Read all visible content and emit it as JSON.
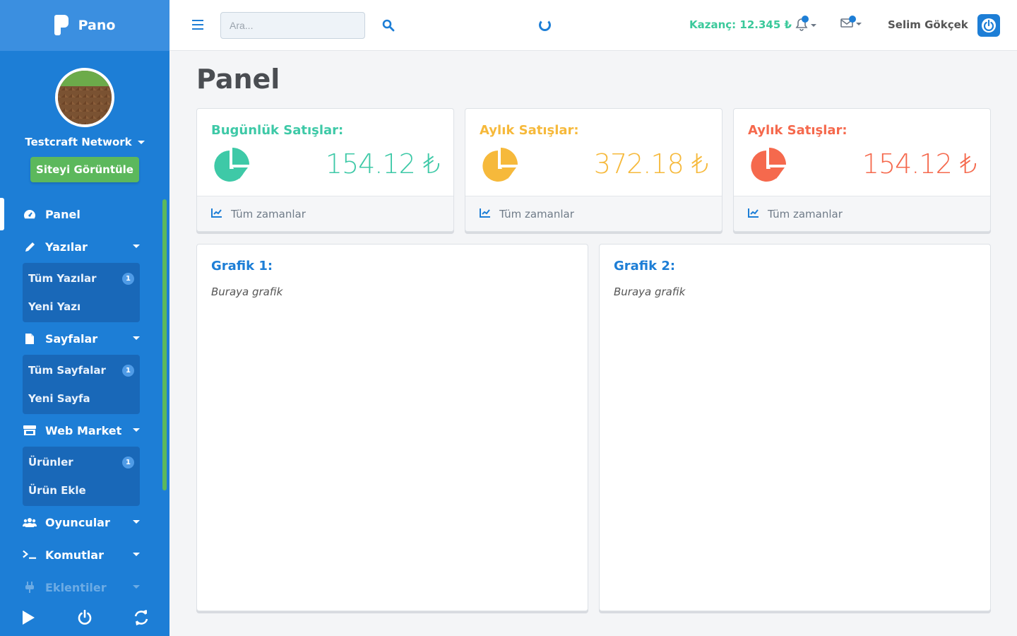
{
  "brand": {
    "name": "Pano"
  },
  "profile": {
    "network_name": "Testcraft Network",
    "view_site_label": "Siteyi Görüntüle"
  },
  "menu": {
    "panel": "Panel",
    "posts": {
      "label": "Yazılar",
      "items": [
        {
          "label": "Tüm Yazılar",
          "badge": "1"
        },
        {
          "label": "Yeni Yazı"
        }
      ]
    },
    "pages": {
      "label": "Sayfalar",
      "items": [
        {
          "label": "Tüm Sayfalar",
          "badge": "1"
        },
        {
          "label": "Yeni Sayfa"
        }
      ]
    },
    "market": {
      "label": "Web Market",
      "items": [
        {
          "label": "Ürünler",
          "badge": "1"
        },
        {
          "label": "Ürün Ekle"
        }
      ]
    },
    "players": "Oyuncular",
    "commands": "Komutlar",
    "plugins": "Eklentiler"
  },
  "topbar": {
    "search_placeholder": "Ara...",
    "earnings": "Kazanç: 12.345 ₺",
    "username": "Selim Gökçek"
  },
  "page": {
    "title": "Panel"
  },
  "stats": [
    {
      "label": "Bugünlük Satışlar:",
      "amount": "154.12 ₺",
      "footer": "Tüm zamanlar",
      "color": "#3ec9a7"
    },
    {
      "label": "Aylık Satışlar:",
      "amount": "372.18 ₺",
      "footer": "Tüm zamanlar",
      "color": "#f6b93b"
    },
    {
      "label": "Aylık Satışlar:",
      "amount": "154.12 ₺",
      "footer": "Tüm zamanlar",
      "color": "#f5694d"
    }
  ],
  "graphs": [
    {
      "title": "Grafik 1:",
      "text": "Buraya grafik"
    },
    {
      "title": "Grafik 2:",
      "text": "Buraya grafik"
    }
  ],
  "colors": {
    "sidebar": "#1d7ed6",
    "accent": "#1d7ed6",
    "success": "#5cb85c"
  }
}
